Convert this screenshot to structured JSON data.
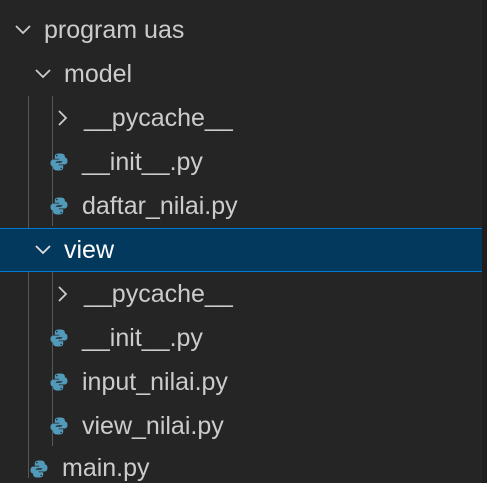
{
  "explorer": {
    "items": [
      {
        "label": "program uas",
        "type": "folder",
        "expanded": true,
        "selected": false
      },
      {
        "label": "model",
        "type": "folder",
        "expanded": true,
        "selected": false
      },
      {
        "label": "__pycache__",
        "type": "folder",
        "expanded": false,
        "selected": false
      },
      {
        "label": "__init__.py",
        "type": "file",
        "icon": "python-file-icon",
        "selected": false
      },
      {
        "label": "daftar_nilai.py",
        "type": "file",
        "icon": "python-file-icon",
        "selected": false
      },
      {
        "label": "view",
        "type": "folder",
        "expanded": true,
        "selected": true
      },
      {
        "label": "__pycache__",
        "type": "folder",
        "expanded": false,
        "selected": false
      },
      {
        "label": "__init__.py",
        "type": "file",
        "icon": "python-file-icon",
        "selected": false
      },
      {
        "label": "input_nilai.py",
        "type": "file",
        "icon": "python-file-icon",
        "selected": false
      },
      {
        "label": "view_nilai.py",
        "type": "file",
        "icon": "python-file-icon",
        "selected": false
      },
      {
        "label": "main.py",
        "type": "file",
        "icon": "python-file-icon",
        "selected": false
      }
    ]
  },
  "colors": {
    "background": "#252526",
    "selected_background": "#04395e",
    "selected_border": "#0078d4",
    "text": "#cccccc",
    "python_icon": "#519aba"
  }
}
